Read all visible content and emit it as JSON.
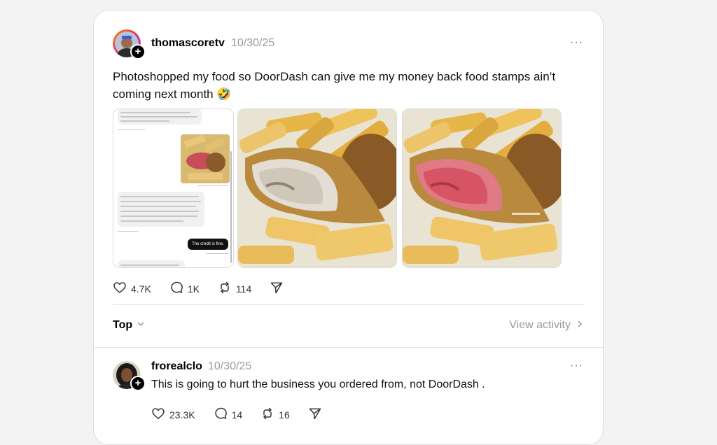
{
  "post": {
    "username": "thomascoretv",
    "date": "10/30/25",
    "more": "···",
    "text": "Photoshopped my food so DoorDash can give me my money back food stamps ain’t coming next month 🤣",
    "likes": "4.7K",
    "comments": "1K",
    "reposts": "114",
    "screenshot": {
      "credit_text": "The credit is fine."
    }
  },
  "sort": {
    "label": "Top",
    "view_activity": "View activity"
  },
  "reply": {
    "username": "frorealclo",
    "date": "10/30/25",
    "more": "···",
    "text": "This is going to hurt the business you ordered from, not DoorDash .",
    "likes": "23.3K",
    "comments": "14",
    "reposts": "16"
  },
  "icons": {
    "like": "heart-icon",
    "comment": "comment-icon",
    "repost": "repost-icon",
    "share": "send-icon",
    "chevron_down": "chevron-down-icon",
    "chevron_right": "chevron-right-icon"
  }
}
